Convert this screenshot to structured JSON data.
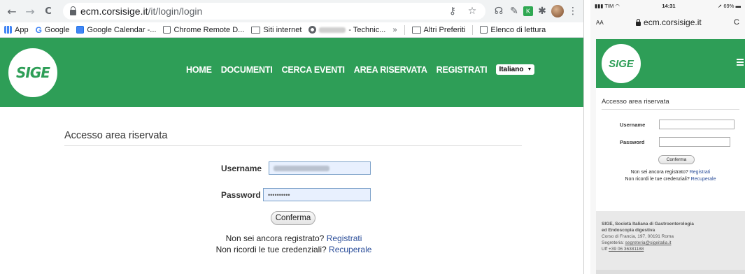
{
  "desktop": {
    "toolbar": {
      "back_icon": "←",
      "forward_icon": "→",
      "reload_icon": "C",
      "url_host": "ecm.corsisige.it",
      "url_path": "/it/login/login"
    },
    "bookmarks": [
      {
        "label": "App",
        "icon": "apps-icon"
      },
      {
        "label": "Google",
        "icon": "google-icon"
      },
      {
        "label": "Google Calendar -...",
        "icon": "calendar-icon"
      },
      {
        "label": "Chrome Remote D...",
        "icon": "remote-icon"
      },
      {
        "label": "Siti internet",
        "icon": "folder-icon"
      },
      {
        "label": "- Technic...",
        "icon": "chrome-icon"
      },
      {
        "label": "»",
        "icon": ""
      },
      {
        "label": "Altri Preferiti",
        "icon": "folder-icon"
      },
      {
        "label": "Elenco di lettura",
        "icon": "reading-list-icon"
      }
    ],
    "site": {
      "logo_text": "SIGE",
      "menu": [
        "HOME",
        "DOCUMENTI",
        "CERCA EVENTI",
        "AREA RISERVATA",
        "REGISTRATI"
      ],
      "language": "Italiano",
      "brand_color": "#2e9e57"
    },
    "login": {
      "title": "Accesso area riservata",
      "username_label": "Username",
      "username_value": "",
      "password_label": "Password",
      "password_value": "••••••••••",
      "submit_label": "Conferma",
      "not_registered": "Non sei ancora registrato?",
      "register_link": "Registrati",
      "forgot": "Non ricordi le tue credenziali?",
      "recover_link": "Recuperale"
    }
  },
  "mobile": {
    "status": {
      "carrier": "TIM",
      "time": "14:31",
      "battery": "69%"
    },
    "text_size": "AA",
    "url": "ecm.corsisige.it",
    "reload_icon": "C",
    "logo_text": "SIGE",
    "login": {
      "title": "Accesso area riservata",
      "username_label": "Username",
      "password_label": "Password",
      "submit_label": "Conferma",
      "not_registered": "Non sei ancora registrato?",
      "register_link": "Registrati",
      "forgot": "Non ricordi le tue credenziali?",
      "recover_link": "Recuperale"
    },
    "footer": {
      "org_line1": "SIGE, Società Italiana di Gastroenterologia",
      "org_line2": "ed Endoscopia digestiva",
      "address": "Corso di Francia, 197, 00191 Roma",
      "email_label": "Segreteria:",
      "email": "segreteria@sigeitalia.it",
      "phone_label": "Uff",
      "phone": "+39 06 36381188"
    }
  }
}
